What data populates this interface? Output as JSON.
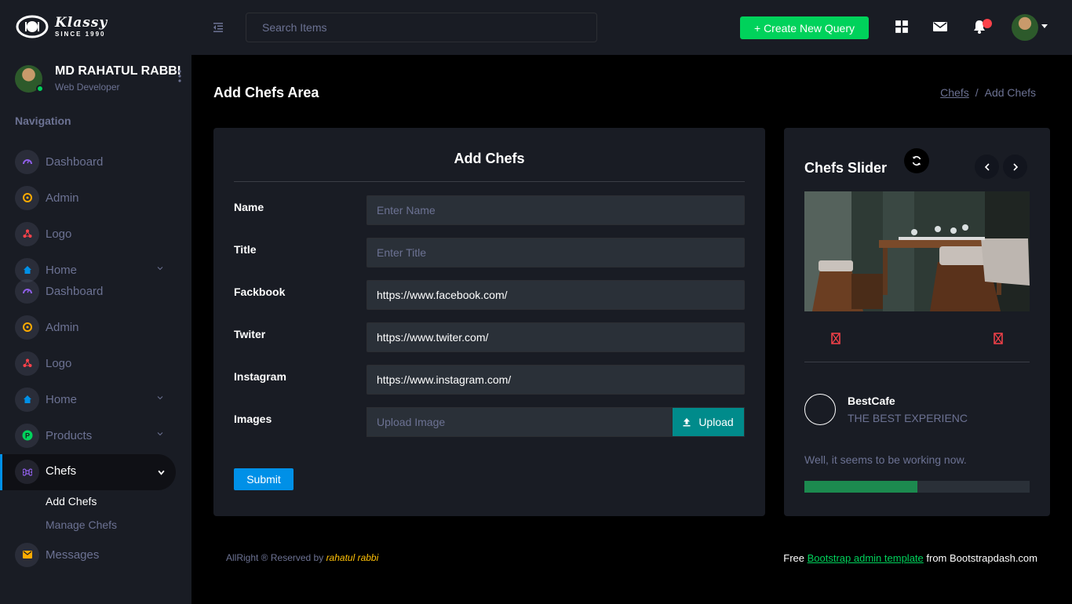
{
  "brand": {
    "name": "Klassy",
    "tagline": "SINCE 1990"
  },
  "topbar": {
    "search_placeholder": "Search Items",
    "create_button": "+ Create New Query",
    "icons": [
      "grid-icon",
      "mail-icon",
      "bell-icon"
    ]
  },
  "profile": {
    "name": "MD RAHATUL RABBI",
    "role": "Web Developer"
  },
  "sidebar": {
    "heading": "Navigation",
    "items": [
      {
        "label": "Dashboard",
        "icon": "speedometer-icon",
        "color": "#8f5fe8"
      },
      {
        "label": "Admin",
        "icon": "admin-icon",
        "color": "#ffab00"
      },
      {
        "label": "Logo",
        "icon": "logo-icon",
        "color": "#fc424a"
      },
      {
        "label": "Home",
        "icon": "home-icon",
        "color": "#0090e7"
      },
      {
        "label": "Dashboard",
        "icon": "speedometer-icon",
        "color": "#8f5fe8"
      },
      {
        "label": "Admin",
        "icon": "admin-icon",
        "color": "#ffab00"
      },
      {
        "label": "Logo",
        "icon": "logo-icon",
        "color": "#fc424a"
      },
      {
        "label": "Home",
        "icon": "home-icon",
        "color": "#0090e7"
      },
      {
        "label": "Products",
        "icon": "products-icon",
        "color": "#00d25b"
      },
      {
        "label": "Chefs",
        "icon": "chefs-icon",
        "color": "#8f5fe8"
      },
      {
        "label": "Messages",
        "icon": "message-icon",
        "color": "#ffab00"
      }
    ],
    "sub_items": [
      "Add Chefs",
      "Manage Chefs"
    ]
  },
  "page": {
    "title": "Add Chefs Area",
    "breadcrumb": [
      "Chefs",
      "Add Chefs"
    ]
  },
  "form": {
    "title": "Add Chefs",
    "fields": [
      {
        "label": "Name",
        "value": "",
        "placeholder": "Enter Name"
      },
      {
        "label": "Title",
        "value": "",
        "placeholder": "Enter Title"
      },
      {
        "label": "Fackbook",
        "value": "https://www.facebook.com/",
        "placeholder": ""
      },
      {
        "label": "Twiter",
        "value": "https://www.twiter.com/",
        "placeholder": ""
      },
      {
        "label": "Instagram",
        "value": "https://www.instagram.com/",
        "placeholder": ""
      }
    ],
    "images_label": "Images",
    "upload_placeholder": "Upload Image",
    "upload_button": "Upload",
    "submit_button": "Submit"
  },
  "slider": {
    "title": "Chefs Slider",
    "item_name": "BestCafe",
    "item_sub": "THE BEST EXPERIENC",
    "status": "Well, it seems to be working now.",
    "progress": 0.5
  },
  "footer": {
    "left_prefix": "AllRight ® Reserved by ",
    "left_author": "rahatul rabbi",
    "right_prefix": "Free ",
    "right_link": "Bootstrap admin template",
    "right_suffix": " from Bootstrapdash.com"
  }
}
